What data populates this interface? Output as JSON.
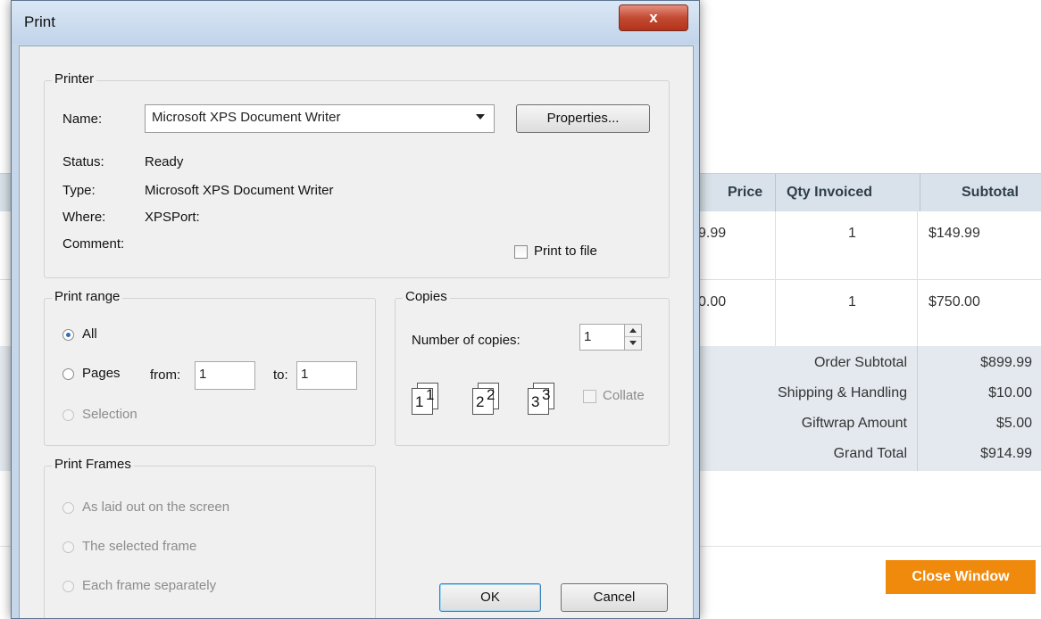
{
  "invoice": {
    "columns": [
      "Price",
      "Qty Invoiced",
      "Subtotal"
    ],
    "rows": [
      {
        "price": "9.99",
        "qty": "1",
        "subtotal": "$149.99"
      },
      {
        "price": "0.00",
        "qty": "1",
        "subtotal": "$750.00"
      }
    ],
    "totals": [
      {
        "label": "Order Subtotal",
        "value": "$899.99"
      },
      {
        "label": "Shipping & Handling",
        "value": "$10.00"
      },
      {
        "label": "Giftwrap Amount",
        "value": "$5.00"
      },
      {
        "label": "Grand Total",
        "value": "$914.99"
      }
    ],
    "close_label": "Close Window",
    "accent_color": "#f08a0c"
  },
  "dialog": {
    "title": "Print",
    "close_glyph": "x",
    "printer": {
      "legend": "Printer",
      "name_label": "Name:",
      "name_value": "Microsoft XPS Document Writer",
      "properties_label": "Properties...",
      "status_label": "Status:",
      "status_value": "Ready",
      "type_label": "Type:",
      "type_value": "Microsoft XPS Document Writer",
      "where_label": "Where:",
      "where_value": "XPSPort:",
      "comment_label": "Comment:",
      "print_to_file_label": "Print to file"
    },
    "print_range": {
      "legend": "Print range",
      "all_label": "All",
      "pages_label": "Pages",
      "from_label": "from:",
      "from_value": "1",
      "to_label": "to:",
      "to_value": "1",
      "selection_label": "Selection"
    },
    "copies": {
      "legend": "Copies",
      "number_label": "Number of copies:",
      "number_value": "1",
      "collate_label": "Collate",
      "page_digits": [
        "1",
        "1",
        "2",
        "2",
        "3",
        "3"
      ]
    },
    "print_frames": {
      "legend": "Print Frames",
      "option1": "As laid out on the screen",
      "option2": "The selected frame",
      "option3": "Each frame separately"
    },
    "ok_label": "OK",
    "cancel_label": "Cancel"
  }
}
